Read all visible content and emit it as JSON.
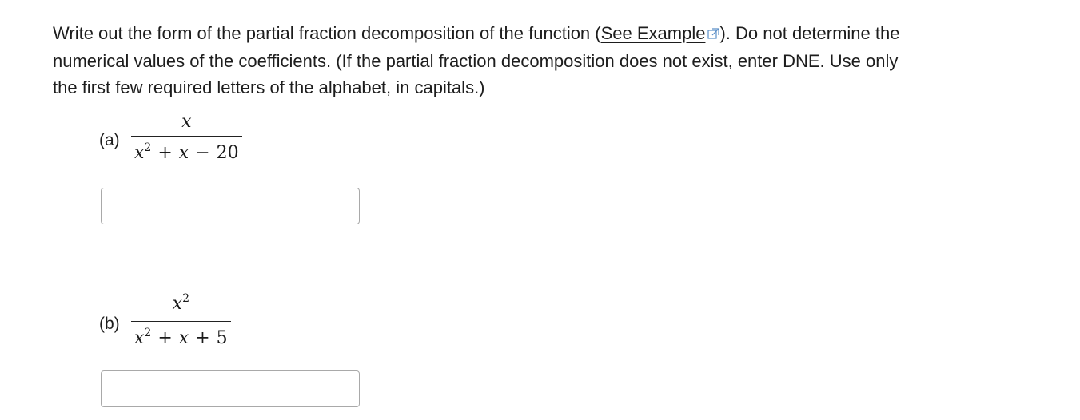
{
  "instructions": {
    "text_before_link": "Write out the form of the partial fraction decomposition of the function (",
    "link_text": "See Example",
    "text_after_link": "). Do not determine the numerical values of the coefficients. (If the partial fraction decomposition does not exist, enter DNE. Use only the first few required letters of the alphabet, in capitals.)",
    "link_icon": "external-link-icon"
  },
  "parts": [
    {
      "label": "(a)",
      "numerator": {
        "var": "x",
        "power": ""
      },
      "denominator": {
        "term1_var": "x",
        "term1_power": "2",
        "op1": "+",
        "term2": "x",
        "op2": "−",
        "term3": "20"
      },
      "answer_value": ""
    },
    {
      "label": "(b)",
      "numerator": {
        "var": "x",
        "power": "2"
      },
      "denominator": {
        "term1_var": "x",
        "term1_power": "2",
        "op1": "+",
        "term2": "x",
        "op2": "+",
        "term3": "5"
      },
      "answer_value": ""
    }
  ],
  "colors": {
    "text": "#1d1d1d",
    "link_icon": "#5b8fc7",
    "input_border": "#a9a9a9"
  }
}
